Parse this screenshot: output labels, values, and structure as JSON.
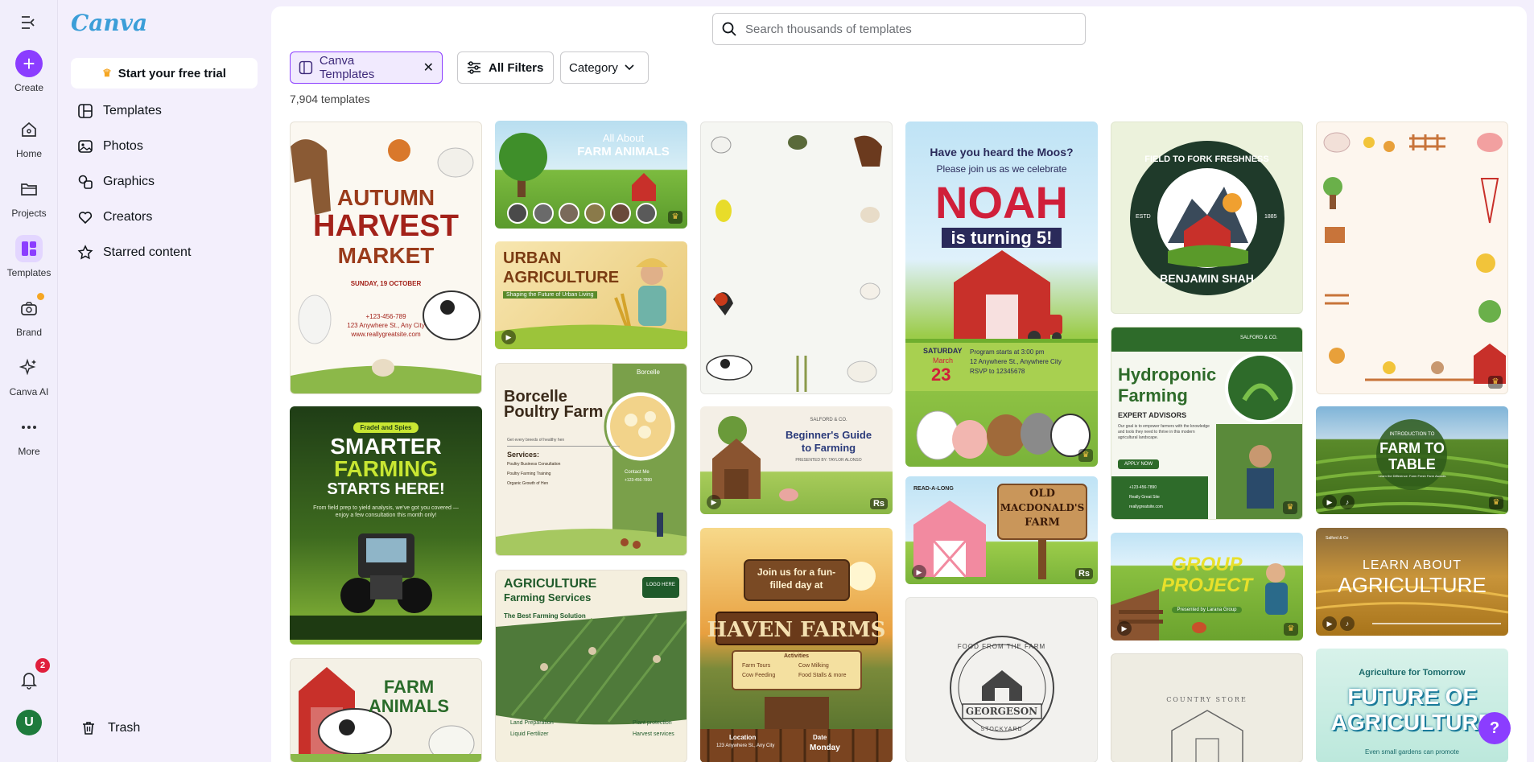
{
  "app": {
    "logo": "Canva"
  },
  "rail": {
    "create": "Create",
    "home": "Home",
    "projects": "Projects",
    "templates": "Templates",
    "brand": "Brand",
    "canva_ai": "Canva AI",
    "more": "More",
    "notification_count": "2",
    "avatar_letter": "U"
  },
  "panel": {
    "trial": "Start your free trial",
    "nav": [
      "Templates",
      "Photos",
      "Graphics",
      "Creators",
      "Starred content"
    ],
    "trash": "Trash"
  },
  "search": {
    "placeholder": "Search thousands of templates"
  },
  "filters": {
    "active_chip": "Canva Templates",
    "all_filters": "All Filters",
    "category": "Category"
  },
  "results_count": "7,904 templates",
  "cards": {
    "autumn": {
      "l1": "AUTUMN",
      "l2": "HARVEST",
      "l3": "MARKET",
      "date": "SUNDAY, 19 OCTOBER",
      "info": "+123-456-789\n123 Anywhere St., Any City\nwww.reallygreatsite.com"
    },
    "farm_animals_banner": {
      "l1": "All About",
      "l2": "FARM ANIMALS"
    },
    "urban": {
      "l1": "URBAN",
      "l2": "AGRICULTURE",
      "sub": "Shaping the Future of Urban Living"
    },
    "poultry": {
      "title": "Borcelle Poultry Farm",
      "brand": "Borcelle",
      "tag": "Get every breeds of healthy hen",
      "services": "Services:",
      "s1": "Poultry Business Consultation",
      "s2": "Poultry Farming Training",
      "s3": "Organic Growth of Hen",
      "contact": "Contact Me",
      "phone": "+123-456-7890"
    },
    "agri_services": {
      "l1": "AGRICULTURE",
      "l2": "Farming Services",
      "sub": "The Best Farming Solution",
      "logo": "LOGO HERE",
      "a": "Land Preparation",
      "b": "Plant protection",
      "c": "Liquid Fertilizer",
      "d": "Harvest services"
    },
    "smarter": {
      "pill": "Fradel and Spies",
      "l1": "SMARTER",
      "l2": "FARMING",
      "l3": "STARTS HERE!",
      "sub": "From field prep to yield analysis, we've got you covered — enjoy a few consultation this month only!"
    },
    "farm_animals": {
      "l1": "FARM",
      "l2": "ANIMALS"
    },
    "beginners": {
      "brand": "SALFORD & CO.",
      "l1": "Beginner's Guide",
      "l2": "to Farming",
      "by": "PRESENTED BY: TAYLOR ALONSO"
    },
    "haven": {
      "l1": "Join us for a fun-",
      "l2": "filled day at",
      "l3": "HAVEN FARMS",
      "act": "Activities",
      "a1": "Farm Tours",
      "a2": "Cow Milking",
      "a3": "Cow Feeding",
      "a4": "Food Stalls & more",
      "loc": "Location",
      "date": "Date",
      "addr": "123 Anywhere St., Any City",
      "day": "Monday"
    },
    "noah": {
      "top": "Have you heard the Moos?",
      "join": "Please join us as we celebrate",
      "name": "NOAH",
      "turning": "is turning 5!",
      "day": "SATURDAY",
      "month": "March",
      "num": "23",
      "p1": "Program starts at 3:00 pm",
      "p2": "12 Anywhere St., Anywhere City",
      "p3": "RSVP to 12345678"
    },
    "macdonald": {
      "tag": "READ-A-LONG",
      "l1": "OLD",
      "l2": "MACDONALD'S",
      "l3": "FARM"
    },
    "georgeson": {
      "top": "FOOD FROM THE FARM",
      "name": "GEORGESON",
      "bottom": "STOCKYARD"
    },
    "badge": {
      "ring": "FIELD TO FORK FRESHNESS",
      "estd": "ESTD",
      "year": "1885",
      "name": "BENJAMIN SHAH"
    },
    "hydro": {
      "brand": "SALFORD & CO.",
      "l1": "Hydroponic",
      "l2": "Farming",
      "sub": "EXPERT ADVISORS",
      "desc": "Our goal is to empower farmers with the knowledge and tools they need to thrive in this modern agricultural landscape.",
      "cta": "APPLY NOW",
      "phone": "+123-456-7890",
      "person": "Really Great Site",
      "site": "reallygreatsite.com"
    },
    "group": {
      "l1": "GROUP",
      "l2": "PROJECT",
      "by": "Presented by Larana Group"
    },
    "country": {
      "text": "COUNTRY STORE"
    },
    "farm_to_table": {
      "intro": "INTRODUCTION TO",
      "l1": "FARM TO",
      "l2": "TABLE",
      "sub": "Learn the Difference: Farm Fresh Farm Awards"
    },
    "learn_agri": {
      "brand": "Salford & Co",
      "l1": "LEARN ABOUT",
      "l2": "AGRICULTURE"
    },
    "future": {
      "top": "Agriculture for Tomorrow",
      "l1": "FUTURE OF",
      "l2": "AGRICULTURE",
      "sub": "Even small gardens can promote"
    }
  },
  "help": "?",
  "colors": {
    "accent": "#8b3dff",
    "brand": "#3b9ed8"
  }
}
